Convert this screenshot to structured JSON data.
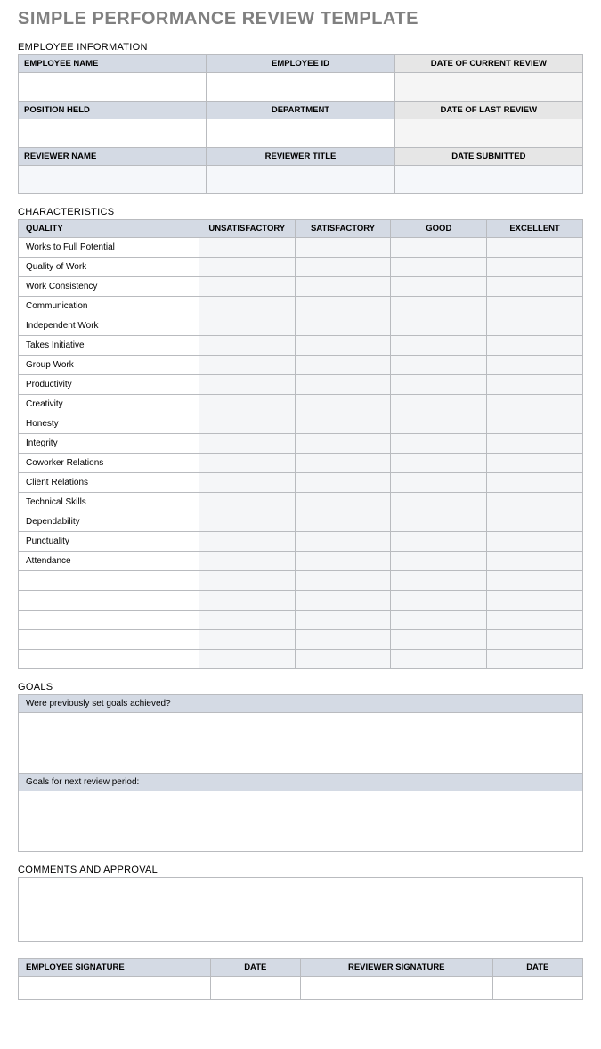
{
  "title": "SIMPLE PERFORMANCE REVIEW TEMPLATE",
  "sections": {
    "employee_info": "EMPLOYEE INFORMATION",
    "characteristics": "CHARACTERISTICS",
    "goals": "GOALS",
    "comments": "COMMENTS AND APPROVAL"
  },
  "emp": {
    "row1": {
      "c1": "EMPLOYEE NAME",
      "c2": "EMPLOYEE ID",
      "c3": "DATE OF CURRENT REVIEW"
    },
    "row2": {
      "c1": "POSITION HELD",
      "c2": "DEPARTMENT",
      "c3": "DATE OF LAST REVIEW"
    },
    "row3": {
      "c1": "REVIEWER NAME",
      "c2": "REVIEWER TITLE",
      "c3": "DATE SUBMITTED"
    }
  },
  "char_headers": {
    "quality": "QUALITY",
    "unsat": "UNSATISFACTORY",
    "sat": "SATISFACTORY",
    "good": "GOOD",
    "exc": "EXCELLENT"
  },
  "char_rows": [
    "Works to Full Potential",
    "Quality of Work",
    "Work Consistency",
    "Communication",
    "Independent Work",
    "Takes Initiative",
    "Group Work",
    "Productivity",
    "Creativity",
    "Honesty",
    "Integrity",
    "Coworker Relations",
    "Client Relations",
    "Technical Skills",
    "Dependability",
    "Punctuality",
    "Attendance",
    "",
    "",
    "",
    "",
    ""
  ],
  "goals": {
    "prev": "Were previously set goals achieved?",
    "next": "Goals for next review period:"
  },
  "sig": {
    "emp_sig": "EMPLOYEE SIGNATURE",
    "date1": "DATE",
    "rev_sig": "REVIEWER SIGNATURE",
    "date2": "DATE"
  }
}
